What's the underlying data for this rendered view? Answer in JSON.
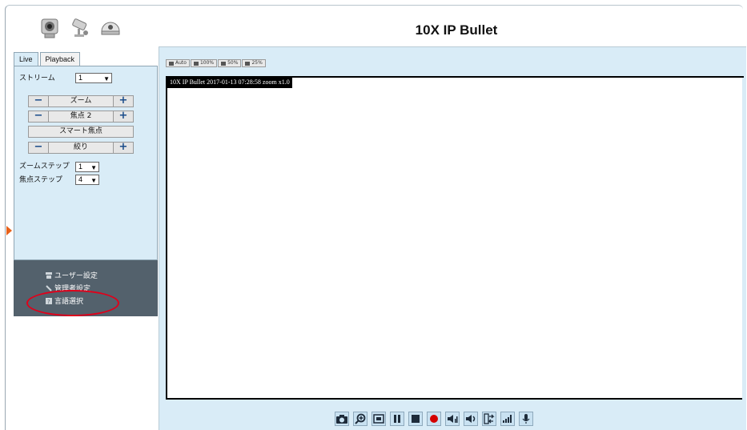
{
  "app": {
    "title": "10X IP Bullet"
  },
  "header": {
    "camera_icons": [
      "camera-dome-icon",
      "camera-bullet-icon",
      "camera-speed-dome-icon"
    ]
  },
  "tabs": [
    {
      "label": "Live",
      "active": true
    },
    {
      "label": "Playback",
      "active": false
    }
  ],
  "controls": {
    "stream_label": "ストリーム",
    "stream_value": "1",
    "zoom_label": "ズーム",
    "focus_label": "焦点 2",
    "smart_focus_label": "スマート焦点",
    "iris_label": "絞り",
    "minus": "−",
    "plus": "+",
    "zoom_step_label": "ズームステップ",
    "zoom_step_value": "1",
    "focus_step_label": "焦点ステップ",
    "focus_step_value": "4"
  },
  "menu": {
    "user_settings": "ユーザー設定",
    "admin_settings": "管理者設定",
    "language": "言語選択"
  },
  "viewer": {
    "scale_buttons": [
      "Auto",
      "100%",
      "50%",
      "25%"
    ],
    "osd_text": "10X IP Bullet 2017-01-13 07:28:58 zoom x1.0"
  },
  "toolbar": {
    "icons": [
      "snapshot-icon",
      "digital-zoom-icon",
      "fit-window-icon",
      "pause-icon",
      "stop-icon",
      "record-icon",
      "audio-in-icon",
      "speaker-icon",
      "stream-switch-icon",
      "volume-level-icon",
      "microphone-icon"
    ]
  },
  "colors": {
    "panel_bg": "#d9ecf7",
    "menu_bg": "#53616c",
    "highlight": "#e0001a",
    "accent": "#1a4c8a"
  }
}
